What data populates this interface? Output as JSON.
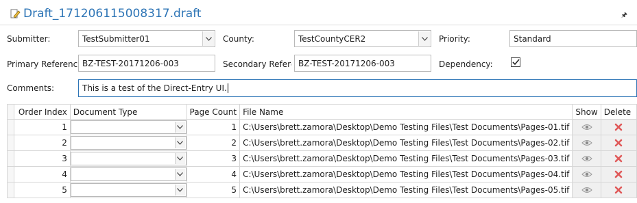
{
  "window": {
    "title": "Draft_171206115008317.draft",
    "pin_glyph": "░"
  },
  "form": {
    "submitter_label": "Submitter:",
    "submitter_value": "TestSubmitter01",
    "county_label": "County:",
    "county_value": "TestCountyCER2",
    "priority_label": "Priority:",
    "priority_value": "Standard",
    "primary_ref_label": "Primary Reference",
    "primary_ref_value": "BZ-TEST-20171206-003",
    "secondary_ref_label": "Secondary Referer",
    "secondary_ref_value": "BZ-TEST-20171206-003",
    "dependency_label": "Dependency:",
    "dependency_checked": true,
    "comments_label": "Comments:",
    "comments_value": "This is a test of the Direct-Entry UI."
  },
  "grid": {
    "headers": {
      "order_index": "Order Index",
      "document_type": "Document Type",
      "page_count": "Page Count",
      "file_name": "File Name",
      "show": "Show",
      "delete": "Delete"
    },
    "rows": [
      {
        "order_index": "1",
        "document_type": "",
        "page_count": "1",
        "file_name": "C:\\Users\\brett.zamora\\Desktop\\Demo Testing Files\\Test Documents\\Pages-01.tif"
      },
      {
        "order_index": "2",
        "document_type": "",
        "page_count": "2",
        "file_name": "C:\\Users\\brett.zamora\\Desktop\\Demo Testing Files\\Test Documents\\Pages-02.tif"
      },
      {
        "order_index": "3",
        "document_type": "",
        "page_count": "3",
        "file_name": "C:\\Users\\brett.zamora\\Desktop\\Demo Testing Files\\Test Documents\\Pages-03.tif"
      },
      {
        "order_index": "4",
        "document_type": "",
        "page_count": "4",
        "file_name": "C:\\Users\\brett.zamora\\Desktop\\Demo Testing Files\\Test Documents\\Pages-04.tif"
      },
      {
        "order_index": "5",
        "document_type": "",
        "page_count": "5",
        "file_name": "C:\\Users\\brett.zamora\\Desktop\\Demo Testing Files\\Test Documents\\Pages-05.tif"
      }
    ]
  },
  "icons": {
    "title": "edit-document-icon",
    "show": "eye-icon",
    "delete": "delete-x-icon",
    "dropdown": "chevron-down-icon",
    "checkbox": "checkmark-icon"
  },
  "colors": {
    "accent": "#2e75b6",
    "delete": "#e05a5a",
    "eye": "#9a9a9a"
  }
}
